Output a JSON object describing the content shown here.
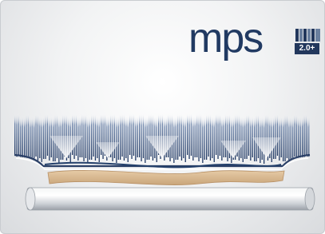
{
  "logo": {
    "wordmark": "mps",
    "version_badge": "2.0+",
    "colors": {
      "wordmark": "#213a62",
      "bars_dark": "#22375c",
      "bars_light": "#6a7f9e",
      "badge_bg": "#22375c"
    }
  },
  "illustration": {
    "description_icons": [
      "pressure-arrow-icon",
      "needle-bed",
      "workpiece-strip",
      "roller"
    ],
    "colors": {
      "needle_dark": "#1d3560",
      "needle_light": "#e8edf5",
      "frame": "#2a3f66",
      "arrow": "#ffffff",
      "strip": "#d7b790",
      "roller": "#cfd3d8"
    }
  }
}
